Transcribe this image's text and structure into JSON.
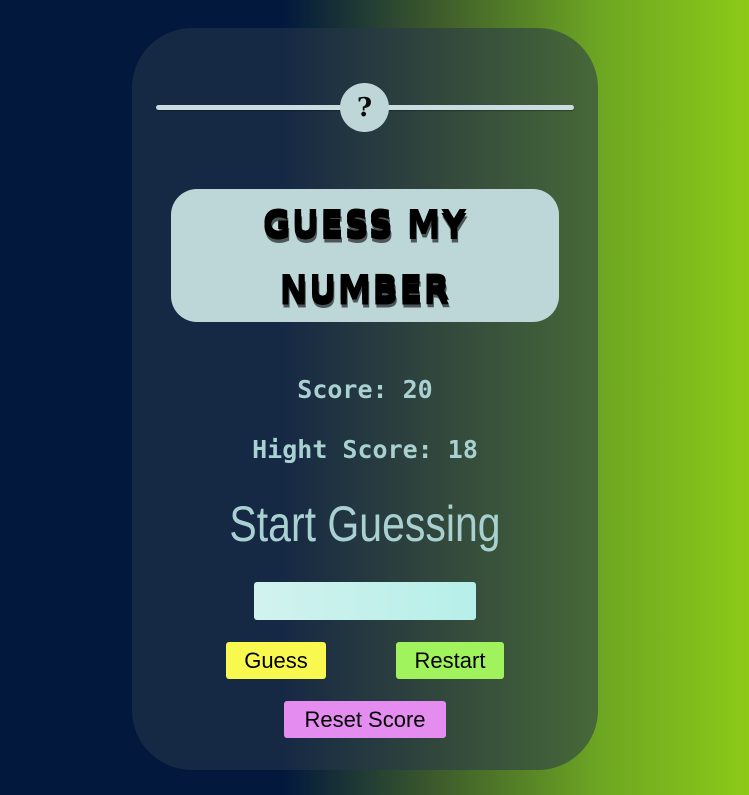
{
  "game": {
    "secret_display": "?",
    "title": "GUESS MY NUMBER",
    "score_text": "Score: 20",
    "high_score_text": "Hight Score: 18",
    "message": "Start Guessing",
    "guess_input": {
      "value": "",
      "placeholder": ""
    },
    "buttons": {
      "guess": "Guess",
      "restart": "Restart",
      "reset_score": "Reset Score"
    }
  },
  "colors": {
    "background_left": "#02193d",
    "background_right": "#8cca18",
    "accent_text": "#a9d1d1",
    "title_box": "#bdd7d9",
    "guess_button": "#f8f84e",
    "restart_button": "#a0f35c",
    "reset_button": "#e48cf0"
  }
}
